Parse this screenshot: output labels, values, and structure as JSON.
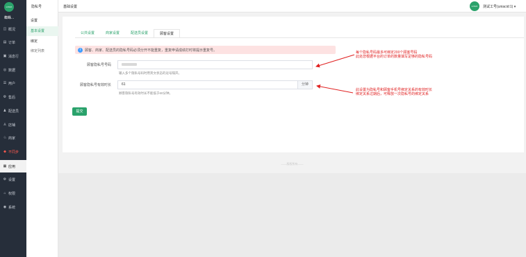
{
  "brand": {
    "logo_text": "LOGO",
    "name": "蜘蛛..."
  },
  "sidebar": {
    "items": [
      {
        "icon": "overview-icon",
        "glyph": "◫",
        "label": "概况"
      },
      {
        "icon": "order-icon",
        "glyph": "▤",
        "label": "订单"
      },
      {
        "icon": "hall-icon",
        "glyph": "▣",
        "label": "消息行"
      },
      {
        "icon": "data-icon",
        "glyph": "◎",
        "label": "数据"
      },
      {
        "icon": "user-icon",
        "glyph": "☰",
        "label": "用户"
      },
      {
        "icon": "aftersale-icon",
        "glyph": "⚙",
        "label": "售后"
      },
      {
        "icon": "rider-icon",
        "glyph": "♟",
        "label": "配送员"
      },
      {
        "icon": "goods-icon",
        "glyph": "♙",
        "label": "店铺"
      },
      {
        "icon": "merchant-icon",
        "glyph": "♘",
        "label": "商家"
      },
      {
        "icon": "danger-icon",
        "glyph": "◆",
        "label": "不同步"
      },
      {
        "icon": "app-icon",
        "glyph": "▦",
        "label": "应用"
      },
      {
        "icon": "settings-icon",
        "glyph": "⚙",
        "label": "设置"
      },
      {
        "icon": "permission-icon",
        "glyph": "⌂",
        "label": "权限"
      },
      {
        "icon": "system-icon",
        "glyph": "◉",
        "label": "系统"
      }
    ]
  },
  "subnav": {
    "title": "隐私号",
    "items": [
      {
        "label": "设置"
      },
      {
        "label": "基本设置"
      },
      {
        "label": "绑定"
      },
      {
        "label": "绑定列表"
      }
    ]
  },
  "topbar": {
    "breadcrumb": "基础设置",
    "avatar_text": "LOGO",
    "user": "测试工号(uniacid:1) ▾"
  },
  "tabs": [
    {
      "label": "公共设置"
    },
    {
      "label": "商家设置"
    },
    {
      "label": "配送员设置"
    },
    {
      "label": "顾客设置"
    }
  ],
  "alert": "顾客、商家、配送员的隐私号码必须分开不能重复，重复申请成绩打时将提示重复号。",
  "form": {
    "pool_label": "顾客隐私号号码",
    "pool_hint": "输入多个隐私号码时用英文状态的逗号隔开。",
    "duration_label": "顾客隐私号有效时长",
    "duration_value": "61",
    "duration_unit": "分钟",
    "duration_hint": "顾客隐私号有效时长不能低于60分钟。",
    "submit": "提交"
  },
  "annotations": [
    {
      "line1": "每个隐私号码最多可绑定200个顾客号码",
      "line2": "此处您根据平台的订单的数量填写足够的隐私号码"
    },
    {
      "line1": "此设置为隐私号和顾客手机号绑定关系的有效时长",
      "line2": "绑定关系过期后，可释放一次隐私号的绑定关系"
    }
  ],
  "footer": "——版权所有——",
  "colors": {
    "accent": "#2aa26b",
    "sidebar": "#262e3a",
    "alert_bg": "#fde2e2",
    "annotation": "#e02020"
  }
}
